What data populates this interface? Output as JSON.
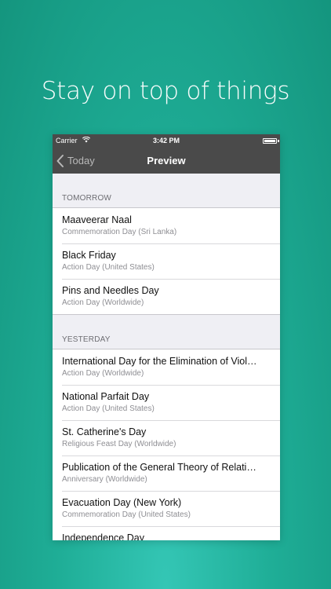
{
  "headline": "Stay on top of things",
  "status_bar": {
    "carrier": "Carrier",
    "time": "3:42 PM"
  },
  "nav_bar": {
    "back_label": "Today",
    "title": "Preview"
  },
  "sections": [
    {
      "header": "TOMORROW",
      "rows": [
        {
          "title": "Maaveerar Naal",
          "subtitle": "Commemoration Day (Sri Lanka)"
        },
        {
          "title": "Black Friday",
          "subtitle": "Action Day (United States)"
        },
        {
          "title": "Pins and Needles Day",
          "subtitle": "Action Day (Worldwide)"
        }
      ]
    },
    {
      "header": "YESTERDAY",
      "rows": [
        {
          "title": "International Day for the Elimination of Viol…",
          "subtitle": "Action Day (Worldwide)"
        },
        {
          "title": "National Parfait Day",
          "subtitle": "Action Day (United States)"
        },
        {
          "title": "St. Catherine's Day",
          "subtitle": "Religious Feast Day (Worldwide)"
        },
        {
          "title": "Publication of the General Theory of Relati…",
          "subtitle": "Anniversary (Worldwide)"
        },
        {
          "title": "Evacuation Day (New York)",
          "subtitle": "Commemoration Day (United States)"
        },
        {
          "title": "Independence Day",
          "subtitle": ""
        }
      ]
    }
  ],
  "colors": {
    "background_accent": "#1fae97",
    "bar_dark": "#4a4a4a",
    "table_background": "#efeff4"
  },
  "icons": [
    "wifi-icon",
    "battery-icon",
    "back-chevron-icon"
  ]
}
